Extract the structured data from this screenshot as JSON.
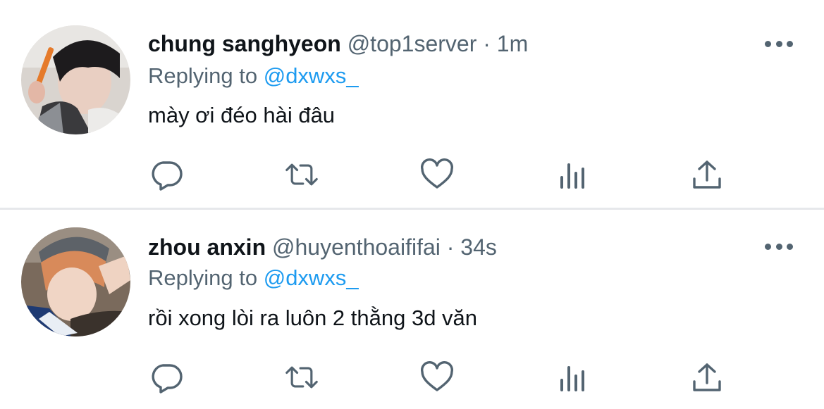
{
  "tweets": [
    {
      "display_name": "chung sanghyeon",
      "username": "@top1server",
      "separator": "·",
      "time": "1m",
      "replying_prefix": "Replying to",
      "replying_handle": "@dxwxs_",
      "text": "mày ơi đéo hài đâu",
      "avatar_icon": "profile-photo",
      "actions": [
        "reply-icon",
        "retweet-icon",
        "like-icon",
        "views-icon",
        "share-icon"
      ]
    },
    {
      "display_name": "zhou anxin",
      "username": "@huyenthoaififai",
      "separator": "·",
      "time": "34s",
      "replying_prefix": "Replying to",
      "replying_handle": "@dxwxs_",
      "text": "rồi xong lòi ra luôn 2 thằng 3d văn",
      "avatar_icon": "profile-photo",
      "actions": [
        "reply-icon",
        "retweet-icon",
        "like-icon",
        "views-icon",
        "share-icon"
      ]
    }
  ],
  "colors": {
    "text_primary": "#0f1419",
    "text_secondary": "#536471",
    "link": "#1d9bf0",
    "divider": "#e6e8eb"
  }
}
